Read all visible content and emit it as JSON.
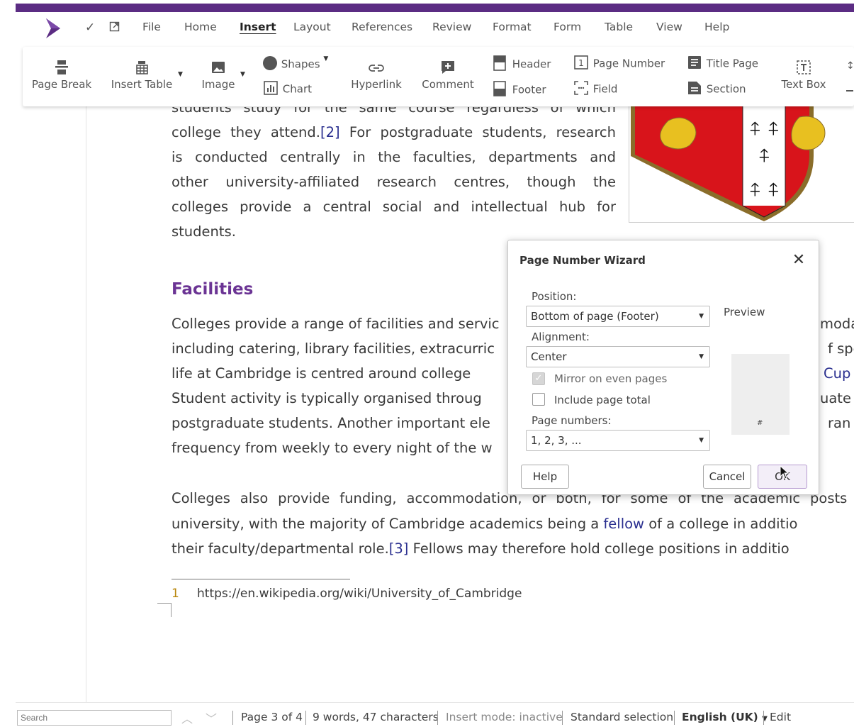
{
  "app": {
    "accent_color": "#5b2c83",
    "heading_color": "#6b3494"
  },
  "menu": {
    "check_icon": "checkmark-icon",
    "external_icon": "open-external-icon",
    "items": [
      "File",
      "Home",
      "Insert",
      "Layout",
      "References",
      "Review",
      "Format",
      "Form",
      "Table",
      "View",
      "Help"
    ],
    "active": "Insert"
  },
  "ribbon": {
    "page_break": "Page Break",
    "insert_table": "Insert Table",
    "image": "Image",
    "shapes": "Shapes",
    "chart": "Chart",
    "hyperlink": "Hyperlink",
    "comment": "Comment",
    "header": "Header",
    "footer": "Footer",
    "page_number": "Page Number",
    "field": "Field",
    "title_page": "Title Page",
    "section": "Section",
    "text_box": "Text Box"
  },
  "document": {
    "para1_line0": "students study for the same course regardless of which",
    "para1_line1a": "college they attend.",
    "para1_line1_ref": "[2]",
    "para1_line1b": " For postgraduate students, research",
    "para1_line2": "is conducted centrally in the faculties, departments and",
    "para1_line3": "other university-affiliated research centres, though the",
    "para1_line4": "colleges provide a central social and intellectual hub for",
    "para1_line5": "students.",
    "heading": "Facilities",
    "para2_line1": "Colleges provide a range of facilities and servic",
    "para2_line1_right": "moda",
    "para2_line2": "including catering, library facilities, extracurric",
    "para2_line2_right": "f spo",
    "para2_line3": "life at Cambridge is centred around college",
    "para2_line3_right": "Cup",
    "para2_line4": "Student activity is typically organised throug",
    "para2_line4_right": "uate",
    "para2_line5": "postgraduate students. Another important ele",
    "para2_line5_right": "ran",
    "para2_line6": "frequency from weekly to every night of the w",
    "para3_line1": "Colleges also provide funding, accommodation, or both, for some of the academic posts in",
    "para3_line2a": "university, with the majority of Cambridge academics being a ",
    "para3_line2_link": "fellow",
    "para3_line2b": " of a college in additio",
    "para3_line3a": "their faculty/departmental role.",
    "para3_line3_ref": "[3]",
    "para3_line3b": " Fellows may therefore hold college positions in additio",
    "footnote_num": "1",
    "footnote_text": "https://en.wikipedia.org/wiki/University_of_Cambridge"
  },
  "dialog": {
    "title": "Page Number Wizard",
    "position_label": "Position:",
    "position_value": "Bottom of page (Footer)",
    "alignment_label": "Alignment:",
    "alignment_value": "Center",
    "mirror_label": "Mirror on even pages",
    "mirror_checked": true,
    "total_label": "Include page total",
    "total_checked": false,
    "page_numbers_label": "Page numbers:",
    "page_numbers_value": "1, 2, 3, ...",
    "preview_label": "Preview",
    "preview_symbol": "#",
    "help": "Help",
    "cancel": "Cancel",
    "ok": "OK"
  },
  "statusbar": {
    "search_placeholder": "Search",
    "page": "Page 3 of 4",
    "words": "9 words, 47 characters",
    "insert_mode": "Insert mode: inactive",
    "selection": "Standard selection",
    "language": "English (UK)",
    "edit": "Edit"
  }
}
